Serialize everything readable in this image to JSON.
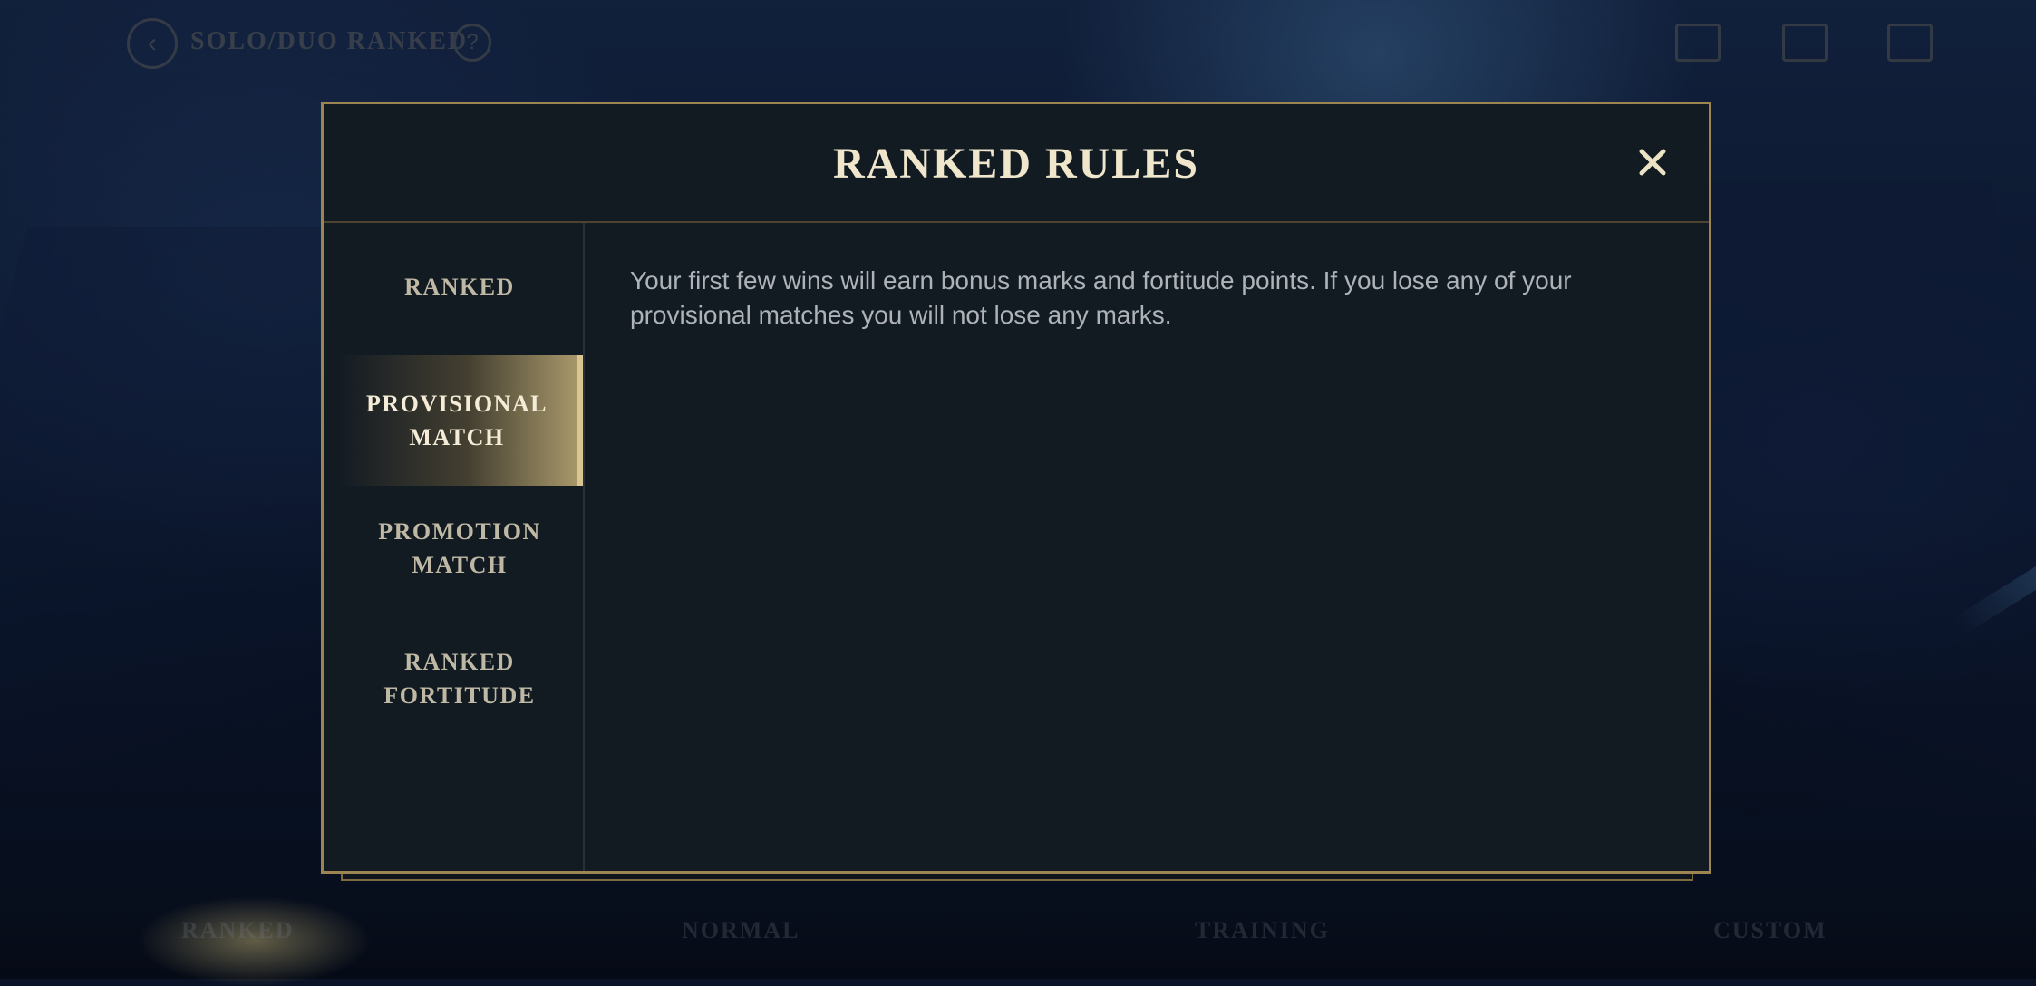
{
  "background": {
    "mode_title": "SOLO/DUO RANKED",
    "bottom_nav": [
      "RANKED",
      "NORMAL",
      "TRAINING",
      "CUSTOM"
    ]
  },
  "dialog": {
    "title": "RANKED RULES",
    "close_label": "✕",
    "tabs": [
      {
        "label": "RANKED",
        "active": false
      },
      {
        "label": "PROVISIONAL\nMATCH",
        "active": true
      },
      {
        "label": "PROMOTION\nMATCH",
        "active": false
      },
      {
        "label": "RANKED\nFORTITUDE",
        "active": false
      }
    ],
    "body_text": "Your first few wins will earn bonus marks and fortitude points. If you lose any of your provisional matches you will not lose any marks."
  },
  "colors": {
    "accent_gold": "#9c8550",
    "title_text": "#efe6cc",
    "panel_bg": "#121a22"
  }
}
